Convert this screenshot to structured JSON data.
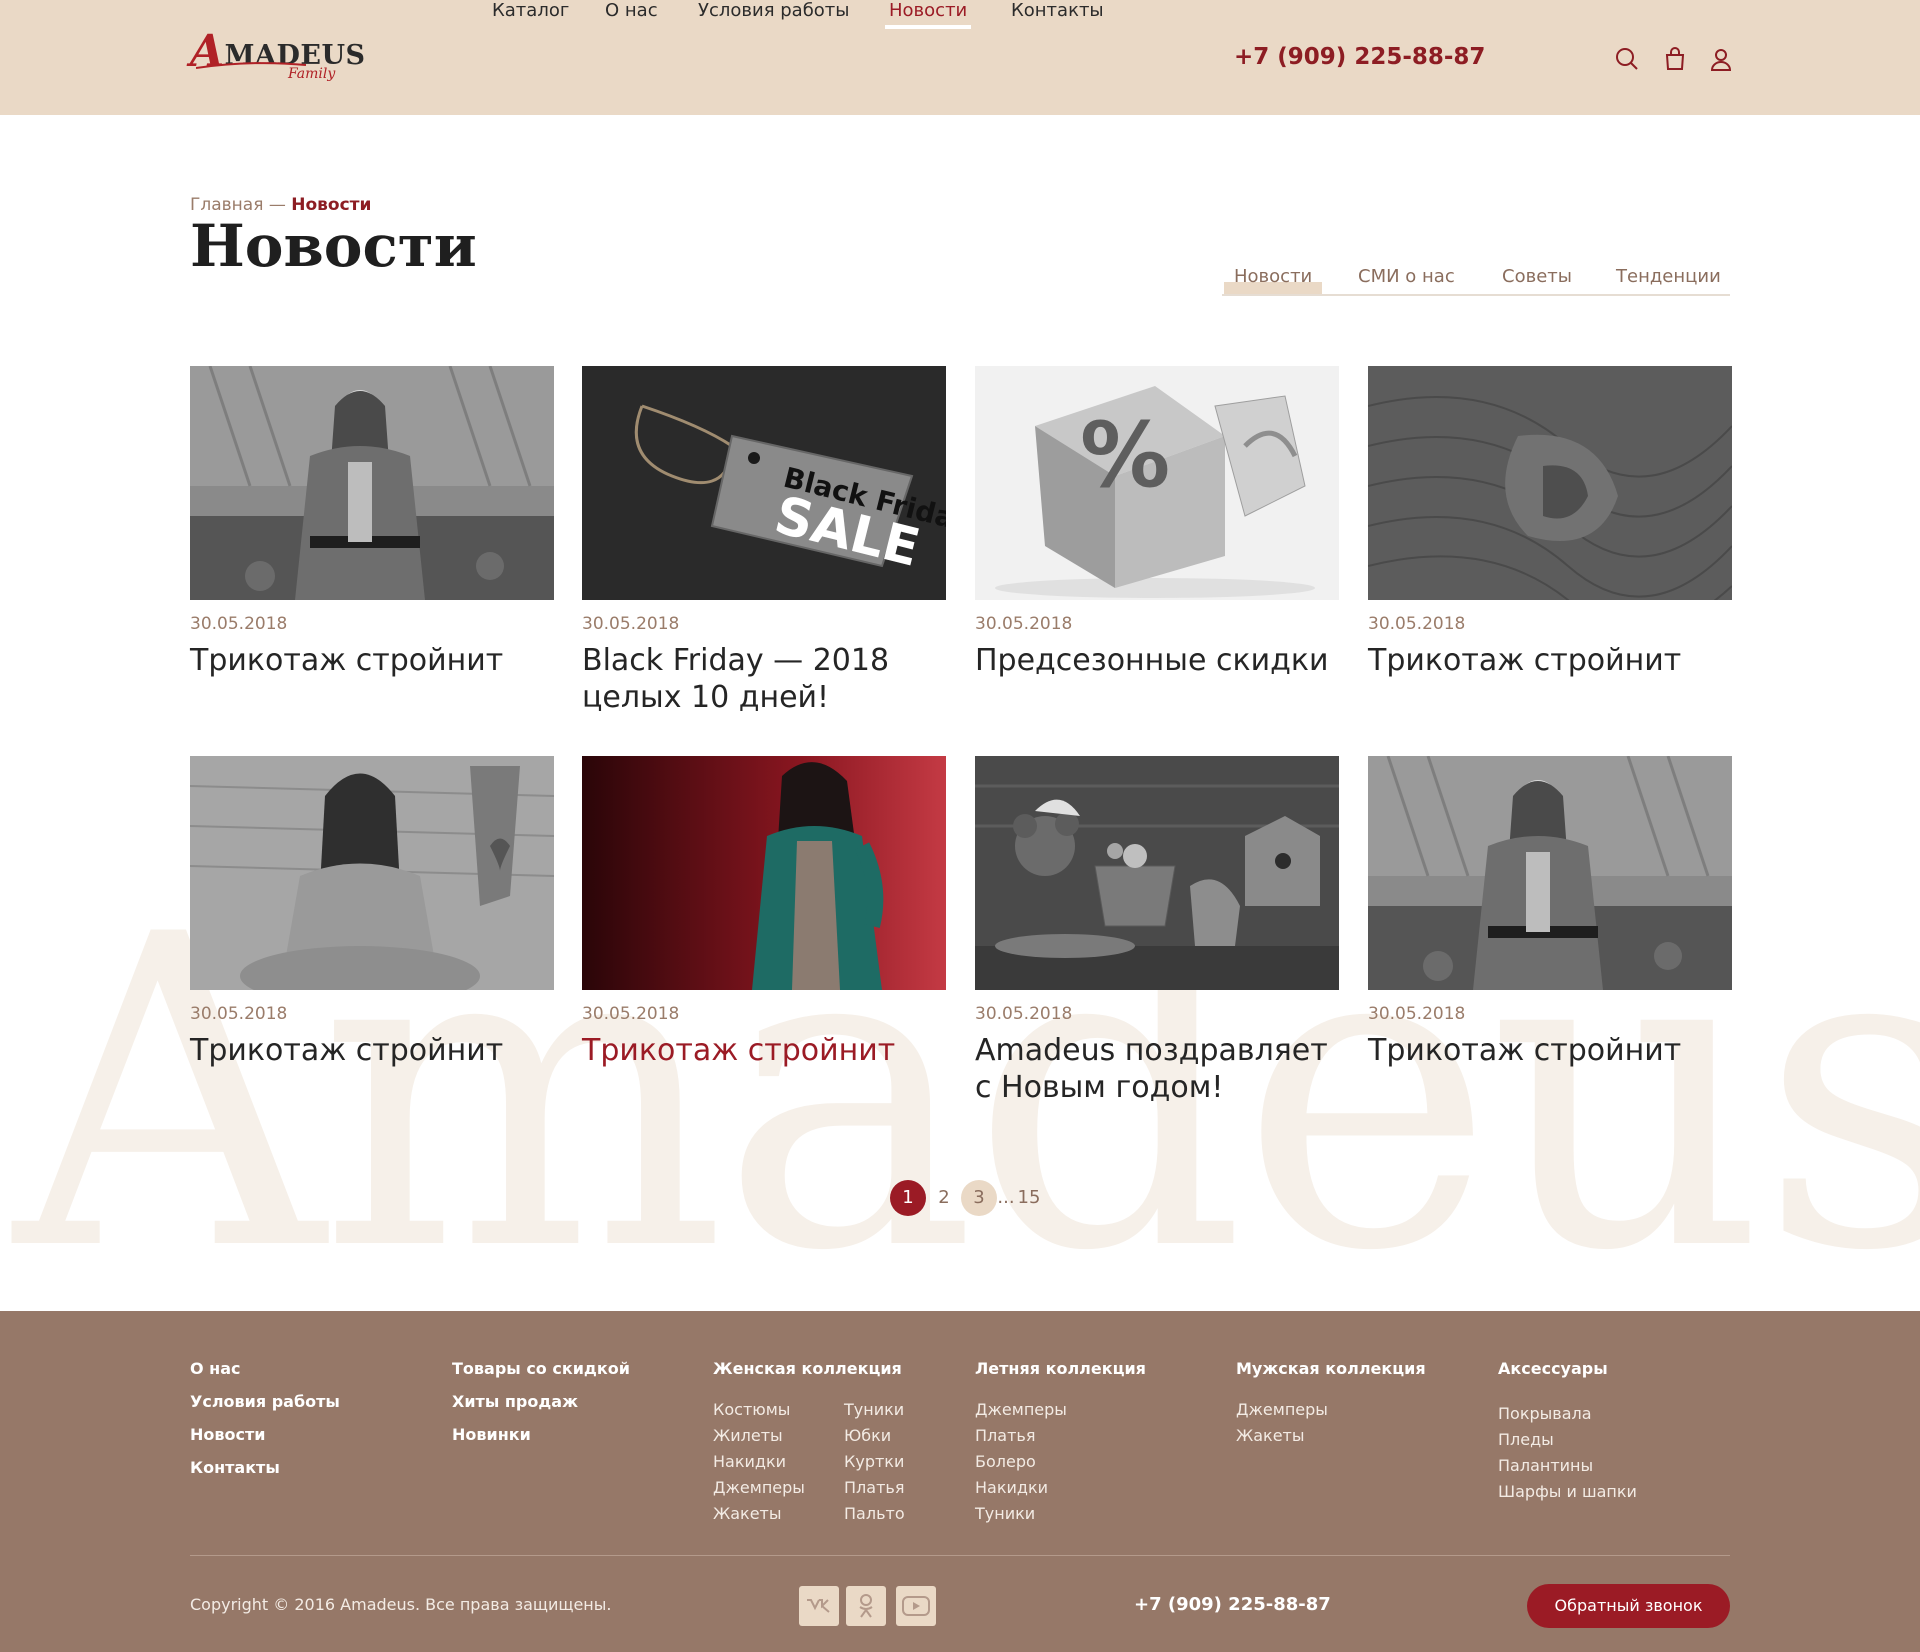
{
  "header": {
    "logo": {
      "big_letter": "A",
      "rest": "MADEUS",
      "sub": "Family"
    },
    "nav": [
      {
        "label": "Каталог"
      },
      {
        "label": "О нас"
      },
      {
        "label": "Условия работы"
      },
      {
        "label": "Новости",
        "active": true
      },
      {
        "label": "Контакты"
      }
    ],
    "phone": "+7 (909) 225-88-87",
    "icons": [
      "search-icon",
      "bag-icon",
      "user-icon"
    ]
  },
  "breadcrumb": {
    "home": "Главная",
    "separator": " — ",
    "current": "Новости"
  },
  "page_title": "Новости",
  "tabs": [
    {
      "label": "Новости",
      "active": true
    },
    {
      "label": "СМИ о нас"
    },
    {
      "label": "Советы"
    },
    {
      "label": "Тенденции"
    }
  ],
  "watermark": "Amadeus",
  "news": [
    {
      "date": "30.05.2018",
      "title": "Трикотаж стройнит",
      "image": "woman-in-cardigan"
    },
    {
      "date": "30.05.2018",
      "title": "Black Friday — 2018 целых 10 дней!",
      "image": "black-friday-tag",
      "tag_line1": "Black Friday",
      "tag_line2": "SALE"
    },
    {
      "date": "30.05.2018",
      "title": "Предсезонные скидки",
      "image": "percent-gift-box",
      "glyph": "%"
    },
    {
      "date": "30.05.2018",
      "title": "Трикотаж стройнит",
      "image": "knit-fabric"
    },
    {
      "date": "30.05.2018",
      "title": "Трикотаж стройнит",
      "image": "woman-in-sweater"
    },
    {
      "date": "30.05.2018",
      "title": "Трикотаж стройнит",
      "image": "woman-green-cardigan",
      "highlighted": true
    },
    {
      "date": "30.05.2018",
      "title": "Amadeus поздравляет с Новым годом!",
      "image": "christmas-toys"
    },
    {
      "date": "30.05.2018",
      "title": "Трикотаж стройнит",
      "image": "woman-in-cardigan"
    }
  ],
  "pagination": {
    "pages": [
      "1",
      "2",
      "3",
      "...",
      "15"
    ],
    "current": "1",
    "hover": "3"
  },
  "footer": {
    "col1": [
      "О нас",
      "Условия работы",
      "Новости",
      "Контакты"
    ],
    "col2": [
      "Товары со скидкой",
      "Хиты продаж",
      "Новинки"
    ],
    "women": {
      "heading": "Женская коллекция",
      "left": [
        "Костюмы",
        "Жилеты",
        "Накидки",
        "Джемперы",
        "Жакеты"
      ],
      "right": [
        "Туники",
        "Юбки",
        "Куртки",
        "Платья",
        "Пальто"
      ]
    },
    "summer": {
      "heading": "Летняя коллекция",
      "items": [
        "Джемперы",
        "Платья",
        "Болеро",
        "Накидки",
        "Туники"
      ]
    },
    "men": {
      "heading": "Мужская коллекция",
      "items": [
        "Джемперы",
        "Жакеты"
      ]
    },
    "accessories": {
      "heading": "Аксессуары",
      "items": [
        "Покрывала",
        "Пледы",
        "Палантины",
        "Шарфы и шапки"
      ]
    },
    "copyright": "Copyright © 2016 Amadeus. Все права защищены.",
    "social": [
      "vk-icon",
      "odnoklassniki-icon",
      "youtube-icon"
    ],
    "phone": "+7 (909) 225-88-87",
    "callback": "Обратный звонок"
  },
  "colors": {
    "accent": "#9b1b25",
    "header_bg": "#ead9c6",
    "footer_bg": "#967868",
    "muted": "#9a7c6a"
  }
}
